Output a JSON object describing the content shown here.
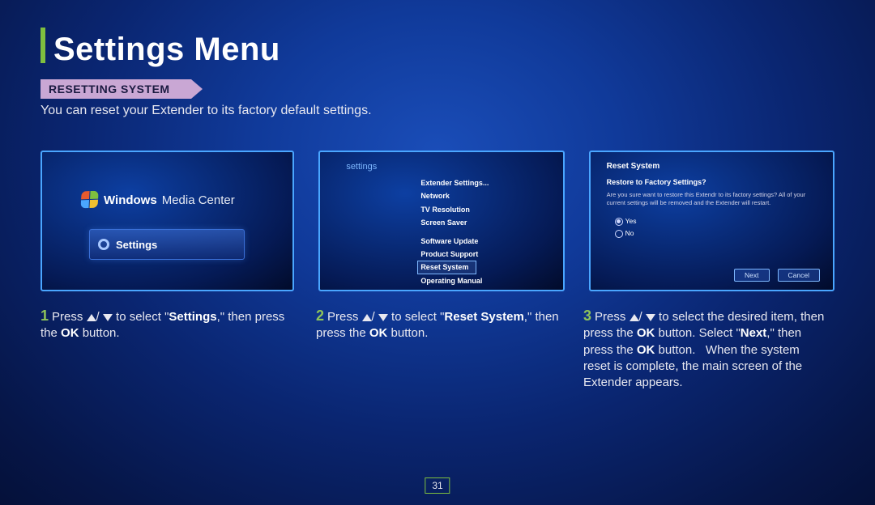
{
  "page": {
    "title": "Settings Menu",
    "section_label": "RESETTING SYSTEM",
    "intro": "You can reset your Extender to its factory default settings.",
    "page_number": "31"
  },
  "screen1": {
    "logo_strong": "Windows",
    "logo_light": "Media Center",
    "tile_label": "Settings"
  },
  "screen2": {
    "header": "settings",
    "items_top": [
      "Extender Settings...",
      "Network",
      "TV Resolution",
      "Screen Saver"
    ],
    "items_bottom": [
      "Software Update",
      "Product Support",
      "Reset System",
      "Operating Manual"
    ],
    "selected": "Reset System"
  },
  "screen3": {
    "title": "Reset System",
    "subtitle": "Restore to Factory Settings?",
    "body": "Are you sure want to restore this Extendr to its factory settings? All of your current settings will be removed and the Extender will restart.",
    "radio_yes": "Yes",
    "radio_no": "No",
    "btn_next": "Next",
    "btn_cancel": "Cancel"
  },
  "steps": {
    "s1_a": "Press ",
    "s1_b": " to select \"",
    "s1_bold": "Settings",
    "s1_c": ",\" then press the ",
    "s1_ok": "OK",
    "s1_d": " button.",
    "s2_a": "Press ",
    "s2_b": " to select \"",
    "s2_bold": "Reset System",
    "s2_c": ",\" then press the ",
    "s2_ok": "OK",
    "s2_d": " button.",
    "s3_a": "Press ",
    "s3_b": " to select the desired item, then press the ",
    "s3_ok1": "OK",
    "s3_c": " button. Select \"",
    "s3_next": "Next",
    "s3_d": ",\" then press the ",
    "s3_ok2": "OK",
    "s3_e": " button.   When the system reset is complete, the main screen of the Extender appears."
  }
}
